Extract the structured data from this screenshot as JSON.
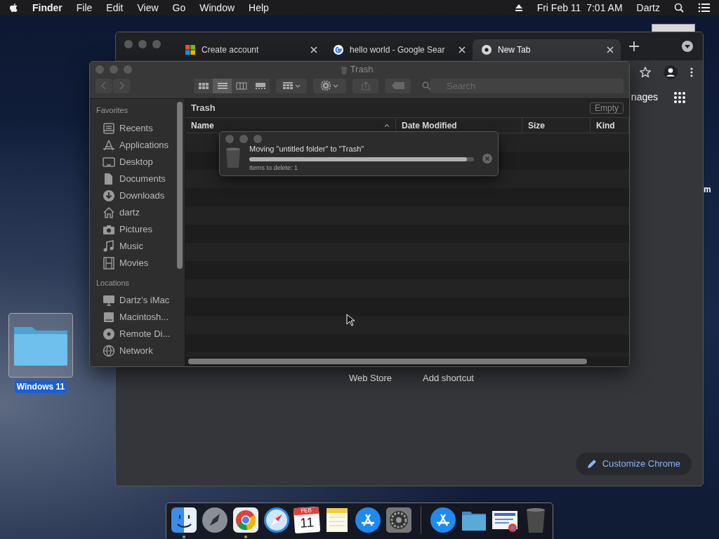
{
  "menu_bar": {
    "app": "Finder",
    "menus": [
      "File",
      "Edit",
      "View",
      "Go",
      "Window",
      "Help"
    ],
    "clock": "Fri Feb 11  7:01 AM",
    "user": "Dartz"
  },
  "desktop": {
    "icons": [
      {
        "label": "Windows 11",
        "selected": true
      }
    ],
    "edge_text": "m"
  },
  "chrome": {
    "tabs": [
      {
        "title": "Create account",
        "kind": "microsoft",
        "selected": false
      },
      {
        "title": "hello world - Google Sear",
        "kind": "google",
        "selected": false
      },
      {
        "title": "New Tab",
        "kind": "chrome",
        "selected": true
      }
    ],
    "header_link": "nages",
    "shortcuts": [
      {
        "label": "Web Store"
      },
      {
        "label": "Add shortcut"
      }
    ],
    "customize_button": "Customize Chrome"
  },
  "finder": {
    "title": "Trash",
    "view_buttons": [
      {
        "kind": "icon",
        "selected": false
      },
      {
        "kind": "list",
        "selected": true
      },
      {
        "kind": "column",
        "selected": false
      },
      {
        "kind": "gallery",
        "selected": false
      }
    ],
    "search": {
      "placeholder": "Search"
    },
    "sidebar": [
      {
        "heading": "Favorites",
        "items": [
          {
            "label": "Recents",
            "kind": "recents"
          },
          {
            "label": "Applications",
            "kind": "applications"
          },
          {
            "label": "Desktop",
            "kind": "desktop"
          },
          {
            "label": "Documents",
            "kind": "documents"
          },
          {
            "label": "Downloads",
            "kind": "downloads"
          },
          {
            "label": "dartz",
            "kind": "home"
          },
          {
            "label": "Pictures",
            "kind": "pictures"
          },
          {
            "label": "Music",
            "kind": "music"
          },
          {
            "label": "Movies",
            "kind": "movies"
          }
        ]
      },
      {
        "heading": "Locations",
        "items": [
          {
            "label": "Dartz’s iMac",
            "kind": "computer"
          },
          {
            "label": "Macintosh...",
            "kind": "disk"
          },
          {
            "label": "Remote Di...",
            "kind": "disc"
          },
          {
            "label": "Network",
            "kind": "network"
          }
        ]
      }
    ],
    "path": "Trash",
    "empty_button": "Empty",
    "columns": [
      "Name",
      "Date Modified",
      "Size",
      "Kind"
    ]
  },
  "progress": {
    "message": "Moving \"untitled folder\" to \"Trash\"",
    "level": 0.97,
    "detail": "Items to delete: 1"
  },
  "dock": {
    "items": [
      {
        "kind": "finder",
        "running": true
      },
      {
        "kind": "launchpad",
        "running": false
      },
      {
        "kind": "chrome",
        "running": true
      },
      {
        "kind": "safari",
        "running": false
      },
      {
        "kind": "calendar",
        "running": false,
        "month": "FEB",
        "day": "11"
      },
      {
        "kind": "notes",
        "running": false
      },
      {
        "kind": "appstore",
        "running": false
      },
      {
        "kind": "settings",
        "running": false
      },
      {
        "kind": "separator"
      },
      {
        "kind": "appstore",
        "running": false
      },
      {
        "kind": "folder",
        "running": false
      },
      {
        "kind": "document",
        "running": false
      },
      {
        "kind": "trash",
        "running": false
      }
    ]
  }
}
